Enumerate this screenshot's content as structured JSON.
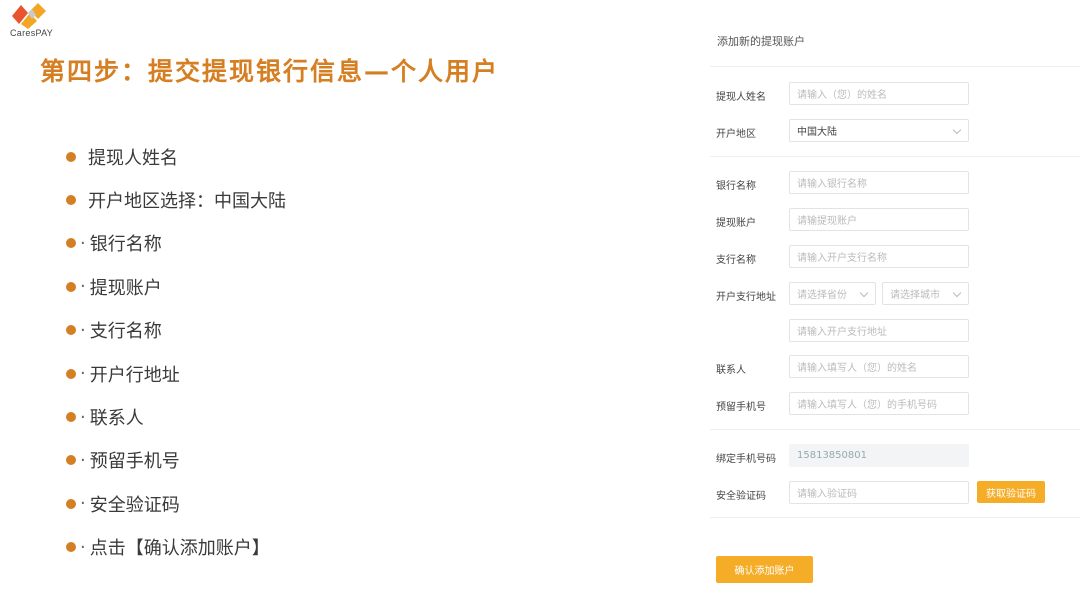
{
  "brand": {
    "logo_text": "CaresPAY",
    "accent_color": "#d67f22",
    "button_color": "#f5ad28"
  },
  "slide": {
    "title": "第四步：提交提现银行信息—个人用户",
    "bullets": [
      {
        "text": "提现人姓名",
        "sep": false
      },
      {
        "text": "开户地区选择：中国大陆",
        "sep": false
      },
      {
        "text": "银行名称",
        "sep": true
      },
      {
        "text": "提现账户",
        "sep": true
      },
      {
        "text": "支行名称",
        "sep": true
      },
      {
        "text": "开户行地址",
        "sep": true
      },
      {
        "text": "联系人",
        "sep": true
      },
      {
        "text": "预留手机号",
        "sep": true
      },
      {
        "text": "安全验证码",
        "sep": true
      },
      {
        "text": "点击【确认添加账户】",
        "sep": true
      }
    ]
  },
  "form": {
    "title": "添加新的提现账户",
    "name": {
      "label": "提现人姓名",
      "placeholder": "请输入（您）的姓名"
    },
    "region": {
      "label": "开户地区",
      "value": "中国大陆"
    },
    "bank_name": {
      "label": "银行名称",
      "placeholder": "请输入银行名称"
    },
    "account": {
      "label": "提现账户",
      "placeholder": "请输提现账户"
    },
    "branch": {
      "label": "支行名称",
      "placeholder": "请输入开户支行名称"
    },
    "branch_address": {
      "label": "开户支行地址",
      "province_placeholder": "请选择省份",
      "city_placeholder": "请选择城市",
      "address_placeholder": "请输入开户支行地址"
    },
    "contact": {
      "label": "联系人",
      "placeholder": "请输入填写人（您）的姓名"
    },
    "phone": {
      "label": "预留手机号",
      "placeholder": "请输入填写人（您）的手机号码"
    },
    "bound_phone": {
      "label": "绑定手机号码",
      "value": "15813850801"
    },
    "code": {
      "label": "安全验证码",
      "placeholder": "请输入验证码",
      "button": "获取验证码"
    },
    "confirm_button": "确认添加账户"
  }
}
